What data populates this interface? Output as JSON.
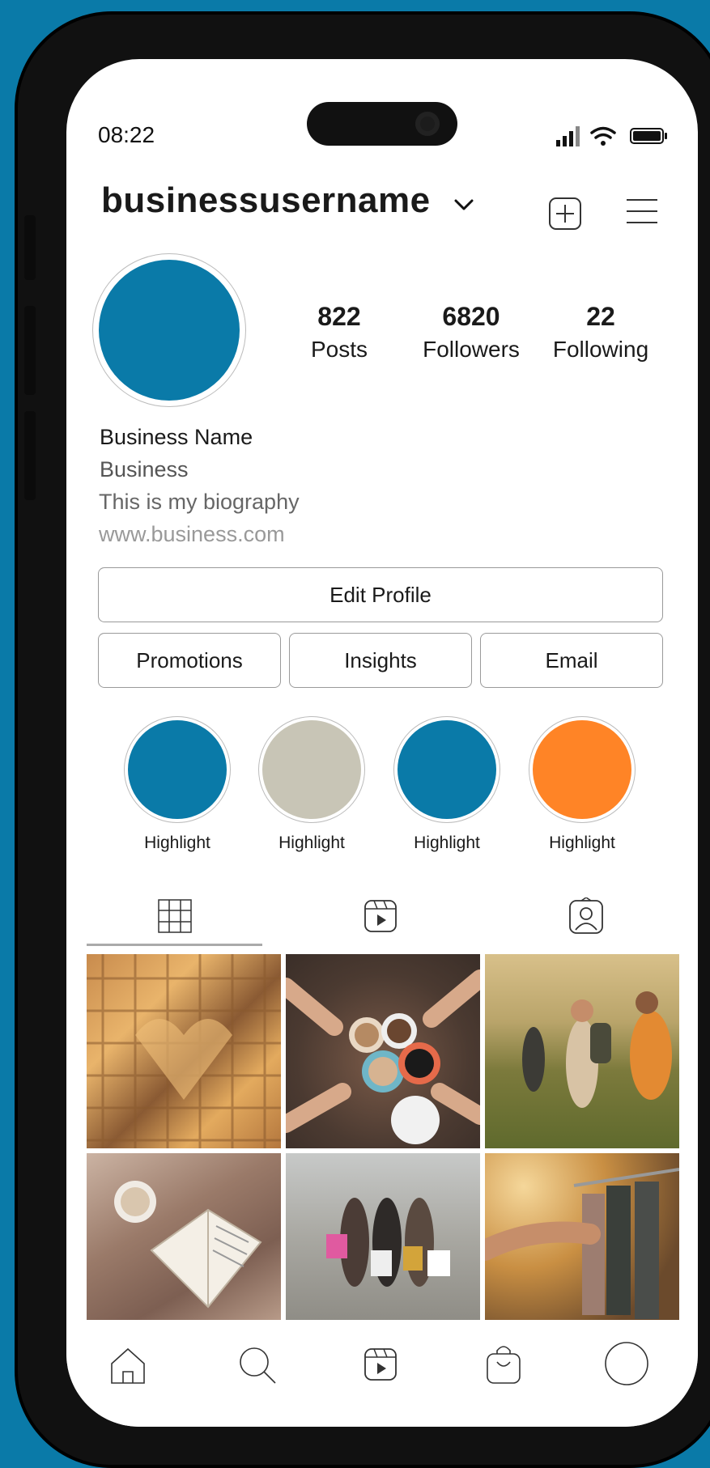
{
  "status_bar": {
    "time": "08:22"
  },
  "header": {
    "username": "businessusername"
  },
  "profile": {
    "stats": [
      {
        "value": "822",
        "label": "Posts"
      },
      {
        "value": "6820",
        "label": "Followers"
      },
      {
        "value": "22",
        "label": "Following"
      }
    ],
    "name": "Business Name",
    "category": "Business",
    "bio": "This is my biography",
    "website": "www.business.com"
  },
  "actions": {
    "edit_profile": "Edit Profile",
    "promotions": "Promotions",
    "insights": "Insights",
    "email": "Email"
  },
  "highlights": [
    {
      "label": "Highlight",
      "color": "#0a7aa8"
    },
    {
      "label": "Highlight",
      "color": "#c8c5b6"
    },
    {
      "label": "Highlight",
      "color": "#0a7aa8"
    },
    {
      "label": "Highlight",
      "color": "#ff8426"
    }
  ],
  "tabs": [
    "grid-icon",
    "reels-icon",
    "tagged-icon"
  ],
  "posts": [
    {
      "subject": "waffles"
    },
    {
      "subject": "coffee cups"
    },
    {
      "subject": "hikers"
    },
    {
      "subject": "book and mug"
    },
    {
      "subject": "shopping friends"
    },
    {
      "subject": "clothing rack"
    }
  ],
  "bottom_nav": [
    "home-icon",
    "search-icon",
    "reels-icon",
    "shop-icon",
    "profile-icon"
  ],
  "colors": {
    "brand": "#0a7aa8",
    "accent": "#ff8426",
    "neutral": "#c8c5b6"
  }
}
